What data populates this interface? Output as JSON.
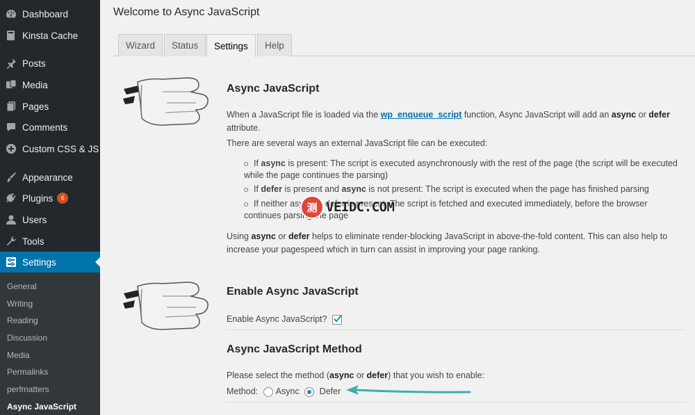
{
  "sidebar": {
    "items": [
      {
        "label": "Dashboard",
        "icon": "dashboard-icon"
      },
      {
        "label": "Kinsta Cache",
        "icon": "kinsta-icon"
      },
      {
        "label": "Posts",
        "icon": "pin-icon"
      },
      {
        "label": "Media",
        "icon": "media-icon"
      },
      {
        "label": "Pages",
        "icon": "pages-icon"
      },
      {
        "label": "Comments",
        "icon": "comments-icon"
      },
      {
        "label": "Custom CSS & JS",
        "icon": "plus-circle-icon"
      },
      {
        "label": "Appearance",
        "icon": "brush-icon"
      },
      {
        "label": "Plugins",
        "icon": "plugin-icon",
        "badge": "6"
      },
      {
        "label": "Users",
        "icon": "users-icon"
      },
      {
        "label": "Tools",
        "icon": "wrench-icon"
      },
      {
        "label": "Settings",
        "icon": "settings-icon"
      }
    ],
    "submenu": [
      "General",
      "Writing",
      "Reading",
      "Discussion",
      "Media",
      "Permalinks",
      "perfmatters",
      "Async JavaScript"
    ]
  },
  "page": {
    "title": "Welcome to Async JavaScript",
    "tabs": [
      "Wizard",
      "Status",
      "Settings",
      "Help"
    ]
  },
  "section1": {
    "title": "Async JavaScript",
    "intro_pre": "When a JavaScript file is loaded via the ",
    "intro_link": "wp_enqueue_script",
    "intro_mid": " function, Async JavaScript will add an ",
    "intro_async": "async",
    "intro_or": " or ",
    "intro_defer": "defer",
    "intro_end": "attribute.",
    "ways": "There are several ways an external JavaScript file can be executed:",
    "b1_pre": "If ",
    "b1_bold": "async",
    "b1_rest": " is present: The script is executed asynchronously with the rest of the page (the script will be executed",
    "b1_line2": "while the page continues the parsing)",
    "b2_pre": "If ",
    "b2_bold1": "defer",
    "b2_mid": " is present and ",
    "b2_bold2": "async",
    "b2_rest": " is not present: The script is executed when the page has finished parsing",
    "b3_line1": "If neither async or defer is present: The script is fetched and executed immediately, before the browser",
    "b3_line2": "continues parsing the page",
    "outro_pre": "Using ",
    "outro_async": "async",
    "outro_or": " or ",
    "outro_defer": "defer",
    "outro_rest": " helps to eliminate render-blocking JavaScript in above-the-fold content. This can also help to",
    "outro_line2": "increase your pagespeed which in turn can assist in improving your page ranking."
  },
  "section2": {
    "title": "Enable Async JavaScript",
    "checkbox_label": "Enable Async JavaScript?",
    "checked": true
  },
  "section3": {
    "title": "Async JavaScript Method",
    "desc_pre": "Please select the method (",
    "desc_async": "async",
    "desc_or": " or ",
    "desc_defer": "defer",
    "desc_post": ") that you wish to enable:",
    "method_label": "Method:",
    "options": [
      "Async",
      "Defer"
    ],
    "selected": "Defer"
  },
  "watermark": {
    "circle": "测",
    "text": "VEIDC.COM"
  },
  "colors": {
    "accent": "#0073aa",
    "arrow": "#3aafb0"
  }
}
